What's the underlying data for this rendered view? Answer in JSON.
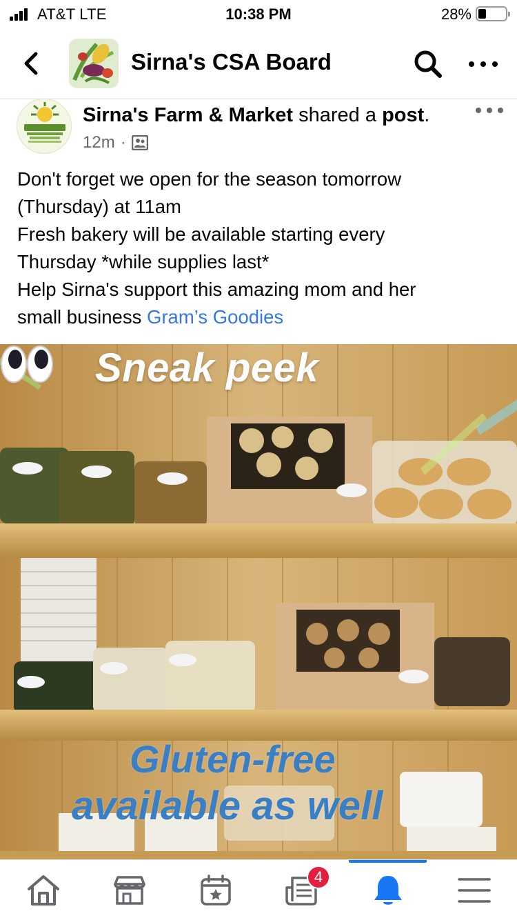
{
  "status_bar": {
    "carrier": "AT&T   LTE",
    "time": "10:38 PM",
    "battery": "28%",
    "battery_level": 0.28
  },
  "header": {
    "title": "Sirna's CSA Board",
    "back_icon": "chevron-left-icon",
    "search_icon": "search-icon",
    "more_icon": "more-horizontal-icon"
  },
  "post": {
    "author": "Sirna's Farm & Market",
    "action": " shared a ",
    "object": "post",
    "period": ".",
    "time": "12m",
    "separator": "·",
    "audience_icon": "group-members-icon",
    "lines": [
      "Don't forget we open for the season tomorrow",
      "(Thursday) at 11am",
      "Fresh bakery will be available starting every",
      "Thursday *while supplies last*",
      "Help Sirna's support this amazing mom and her"
    ],
    "last_line_text": "small business ",
    "mention": "Gram’s Goodies"
  },
  "photo": {
    "overlay_top": "Sneak peek",
    "overlay_bottom_1": "Gluten-free",
    "overlay_bottom_2": "available as well"
  },
  "bottom_nav": {
    "items": [
      {
        "name": "home",
        "icon": "home-icon"
      },
      {
        "name": "marketplace",
        "icon": "marketplace-icon"
      },
      {
        "name": "events",
        "icon": "events-icon"
      },
      {
        "name": "news",
        "icon": "news-icon",
        "badge": "4"
      },
      {
        "name": "notifications",
        "icon": "bell-icon",
        "active": true
      },
      {
        "name": "menu",
        "icon": "hamburger-menu-icon"
      }
    ]
  },
  "colors": {
    "link": "#3578e5",
    "accent": "#1877f2",
    "badge": "#e41e3f",
    "secondary_text": "#65676b"
  }
}
